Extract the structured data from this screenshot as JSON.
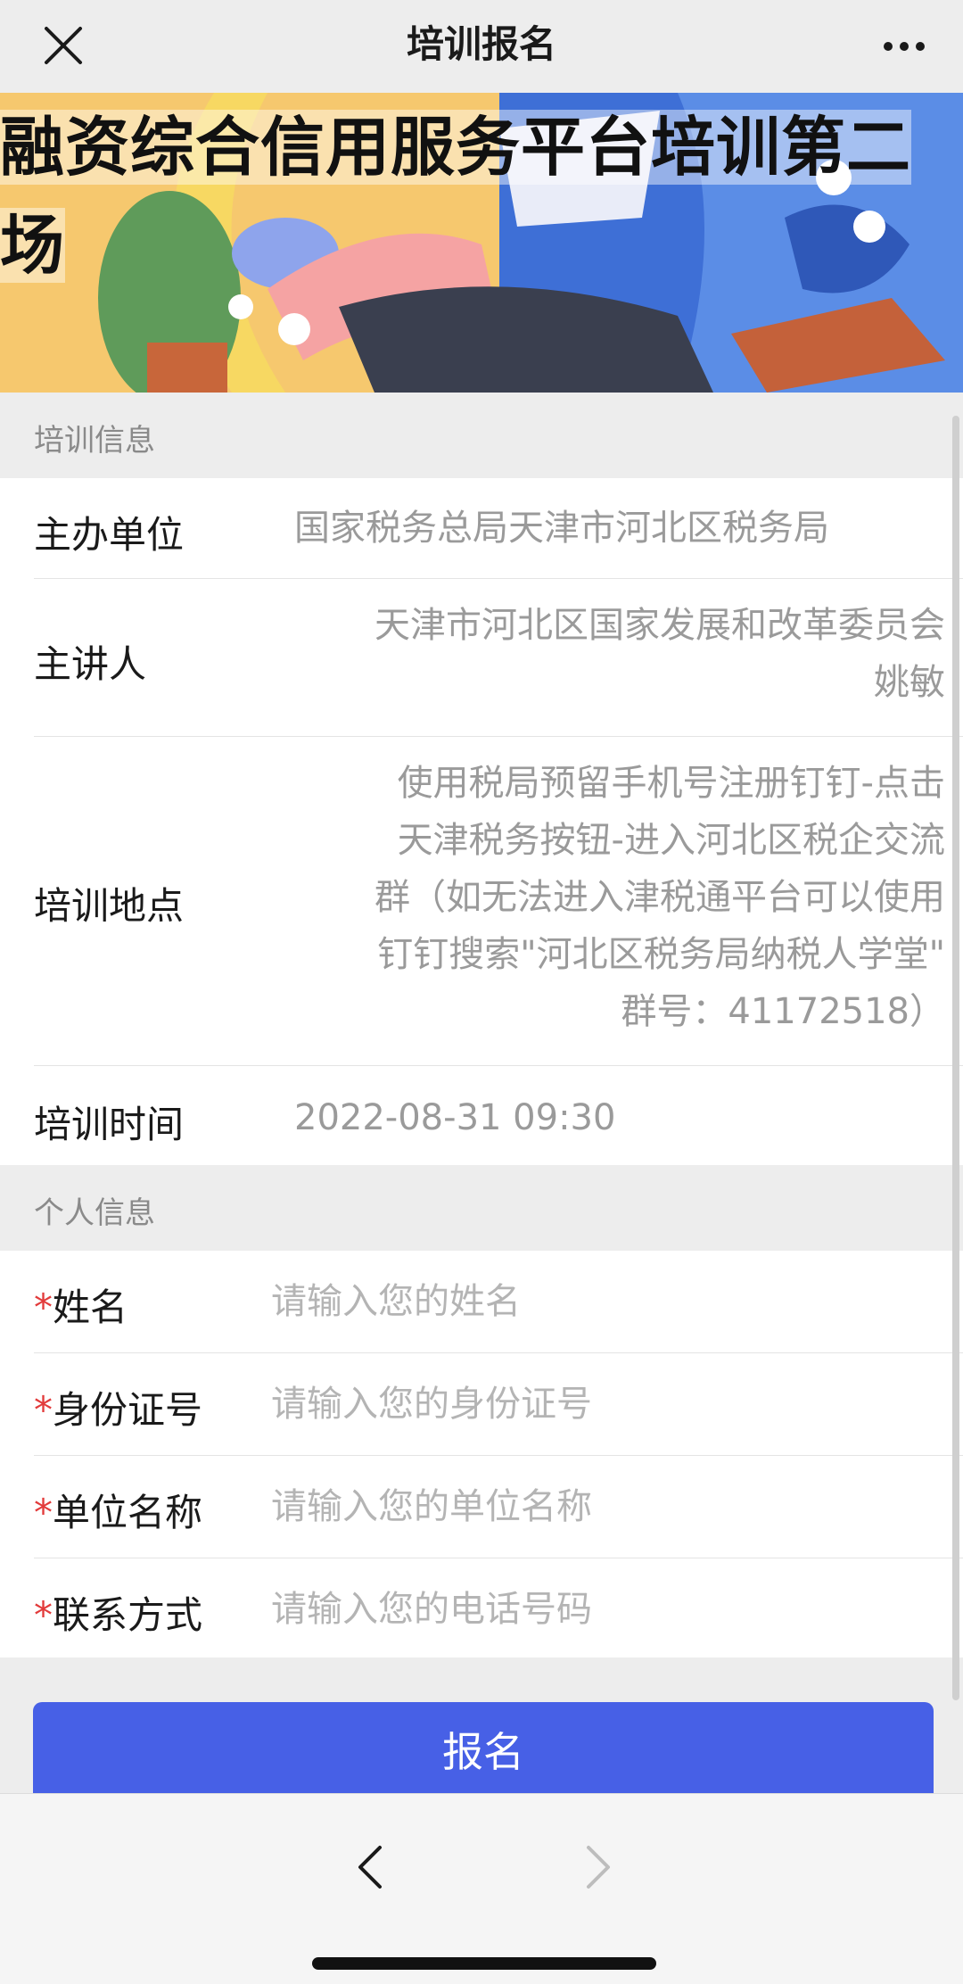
{
  "navbar": {
    "title": "培训报名"
  },
  "banner": {
    "title": "融资综合信用服务平台培训第二场"
  },
  "training_info": {
    "section_title": "培训信息",
    "host_label": "主办单位",
    "host_value": "国家税务总局天津市河北区税务局",
    "speaker_label": "主讲人",
    "speaker_value_line1": "天津市河北区国家发展和改革委员会",
    "speaker_value_line2": "姚敏",
    "location_label": "培训地点",
    "location_lines": [
      "使用税局预留手机号注册钉钉-点击",
      "天津税务按钮-进入河北区税企交流",
      "群（如无法进入津税通平台可以使用",
      "钉钉搜索\"河北区税务局纳税人学堂\"",
      "群号：41172518）"
    ],
    "time_label": "培训时间",
    "time_value": "2022-08-31 09:30"
  },
  "personal_info": {
    "section_title": "个人信息",
    "required_mark": "*",
    "name_label": "姓名",
    "name_placeholder": "请输入您的姓名",
    "id_label": "身份证号",
    "id_placeholder": "请输入您的身份证号",
    "org_label": "单位名称",
    "org_placeholder": "请输入您的单位名称",
    "phone_label": "联系方式",
    "phone_placeholder": "请输入您的电话号码"
  },
  "submit_label": "报名",
  "icons": [
    "close-icon",
    "more-icon",
    "back-arrow-icon",
    "forward-arrow-icon"
  ],
  "colors": {
    "accent": "#4760e6",
    "required": "#e23b3b"
  }
}
